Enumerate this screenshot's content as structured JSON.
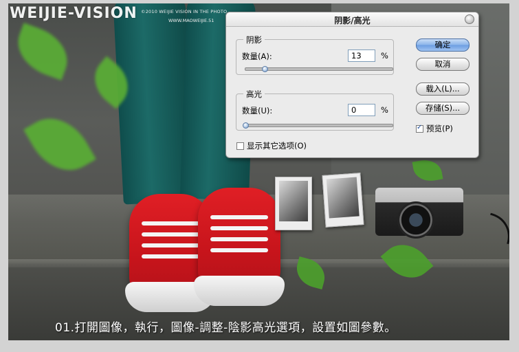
{
  "watermark": {
    "logo": "WEIJIE-VISION",
    "copyright": "©2010 WEIJIE VISION IN THE PHOTO",
    "url": "WWW.MAOWEIJIE.51"
  },
  "caption": "01.打開圖像，執行，圖像-調整-陰影高光選項，設置如圖參數。",
  "dialog": {
    "title": "阴影/高光",
    "shadows": {
      "group_label": "阴影",
      "amount_label": "数量(A):",
      "amount_value": "13",
      "unit": "%",
      "slider_fraction": 0.13
    },
    "highlights": {
      "group_label": "高光",
      "amount_label": "数量(U):",
      "amount_value": "0",
      "unit": "%",
      "slider_fraction": 0.0
    },
    "show_more_options": {
      "label": "显示其它选项(O)",
      "checked": false
    },
    "buttons": {
      "ok": "确定",
      "cancel": "取消",
      "load": "载入(L)...",
      "save": "存储(S)..."
    },
    "preview": {
      "label": "预览(P)",
      "checked": true
    }
  },
  "colors": {
    "dialog_bg": "#ebebeb",
    "default_button": "#8ab4ea",
    "shoe_red": "#d8161d",
    "jeans_teal": "#176360"
  }
}
